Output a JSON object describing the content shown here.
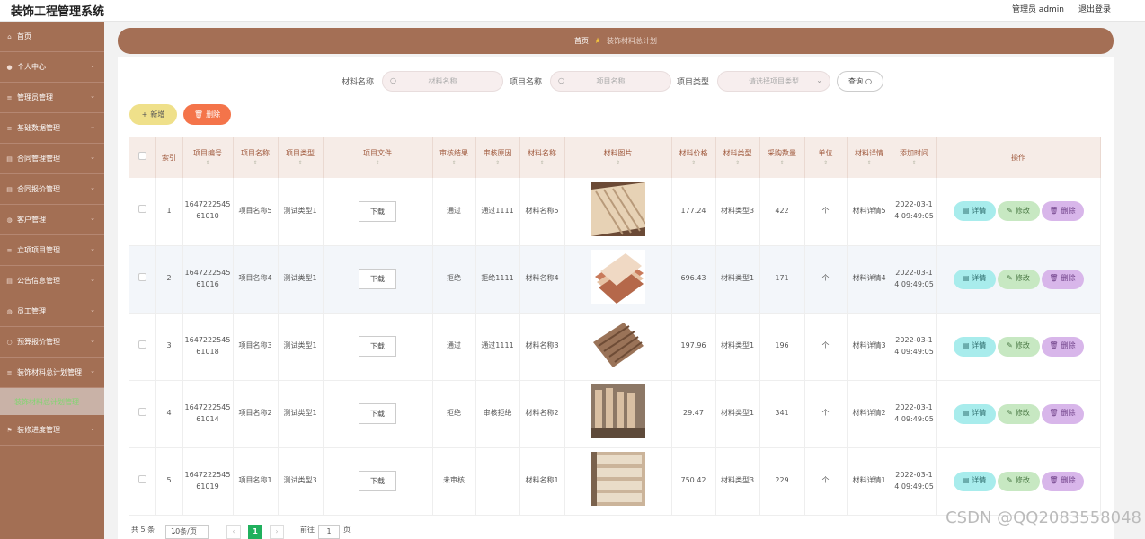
{
  "header": {
    "title": "装饰工程管理系统",
    "user": "管理员 admin",
    "logout": "退出登录"
  },
  "sidebar": {
    "items": [
      {
        "label": "首页",
        "icon": "home-icon"
      },
      {
        "label": "个人中心",
        "icon": "user-icon"
      },
      {
        "label": "管理员管理",
        "icon": "list-icon"
      },
      {
        "label": "基础数据管理",
        "icon": "list-icon"
      },
      {
        "label": "合同管理管理",
        "icon": "doc-icon"
      },
      {
        "label": "合同报价管理",
        "icon": "doc-icon"
      },
      {
        "label": "客户管理",
        "icon": "person-icon"
      },
      {
        "label": "立项项目管理",
        "icon": "list-icon"
      },
      {
        "label": "公告信息管理",
        "icon": "doc-icon"
      },
      {
        "label": "员工管理",
        "icon": "person-icon"
      },
      {
        "label": "预算报价管理",
        "icon": "circle-icon"
      },
      {
        "label": "装饰材料总计划管理",
        "icon": "list-icon"
      }
    ],
    "sub_item": "装饰材料总计划管理",
    "last_item": {
      "label": "装修进度管理",
      "icon": "flag-icon"
    }
  },
  "breadcrumb": {
    "home": "首页",
    "current": "装饰材料总计划"
  },
  "search": {
    "label1": "材料名称",
    "placeholder1": "材料名称",
    "label2": "项目名称",
    "placeholder2": "项目名称",
    "label3": "项目类型",
    "placeholder3": "请选择项目类型",
    "button": "查询"
  },
  "actions": {
    "add": "新增",
    "delete": "删除"
  },
  "table": {
    "headers": [
      "索引",
      "项目编号",
      "项目名称",
      "项目类型",
      "项目文件",
      "审核结果",
      "审核原因",
      "材料名称",
      "材料图片",
      "材料价格",
      "材料类型",
      "采购数量",
      "单位",
      "材料详情",
      "添加时间",
      "操作"
    ],
    "download_label": "下载",
    "op_detail": "详情",
    "op_edit": "修改",
    "op_delete": "删除",
    "rows": [
      {
        "index": "1",
        "code": "164722254561010",
        "name": "项目名称5",
        "type": "测试类型1",
        "result": "通过",
        "reason": "通过1111",
        "material": "材料名称5",
        "price": "177.24",
        "mtype": "材料类型3",
        "qty": "422",
        "unit": "个",
        "detail": "材料详情5",
        "time": "2022-03-14 09:49:05",
        "img": "planks"
      },
      {
        "index": "2",
        "code": "164722254561016",
        "name": "项目名称4",
        "type": "测试类型1",
        "result": "拒绝",
        "reason": "拒绝1111",
        "material": "材料名称4",
        "price": "696.43",
        "mtype": "材料类型1",
        "qty": "171",
        "unit": "个",
        "detail": "材料详情4",
        "time": "2022-03-14 09:49:05",
        "img": "boards"
      },
      {
        "index": "3",
        "code": "164722254561018",
        "name": "项目名称3",
        "type": "测试类型1",
        "result": "通过",
        "reason": "通过1111",
        "material": "材料名称3",
        "price": "197.96",
        "mtype": "材料类型1",
        "qty": "196",
        "unit": "个",
        "detail": "材料详情3",
        "time": "2022-03-14 09:49:05",
        "img": "slotted"
      },
      {
        "index": "4",
        "code": "164722254561014",
        "name": "项目名称2",
        "type": "测试类型1",
        "result": "拒绝",
        "reason": "审核拒绝",
        "material": "材料名称2",
        "price": "29.47",
        "mtype": "材料类型1",
        "qty": "341",
        "unit": "个",
        "detail": "材料详情2",
        "time": "2022-03-14 09:49:05",
        "img": "stack"
      },
      {
        "index": "5",
        "code": "164722254561019",
        "name": "项目名称1",
        "type": "测试类型3",
        "result": "未审核",
        "reason": "",
        "material": "材料名称1",
        "price": "750.42",
        "mtype": "材料类型3",
        "qty": "229",
        "unit": "个",
        "detail": "材料详情1",
        "time": "2022-03-14 09:49:05",
        "img": "panels"
      }
    ]
  },
  "pagination": {
    "total": "共 5 条",
    "page_size": "10条/页",
    "current": "1",
    "goto_prefix": "前往",
    "goto_value": "1",
    "goto_suffix": "页"
  },
  "watermark": "CSDN @QQ2083558048"
}
